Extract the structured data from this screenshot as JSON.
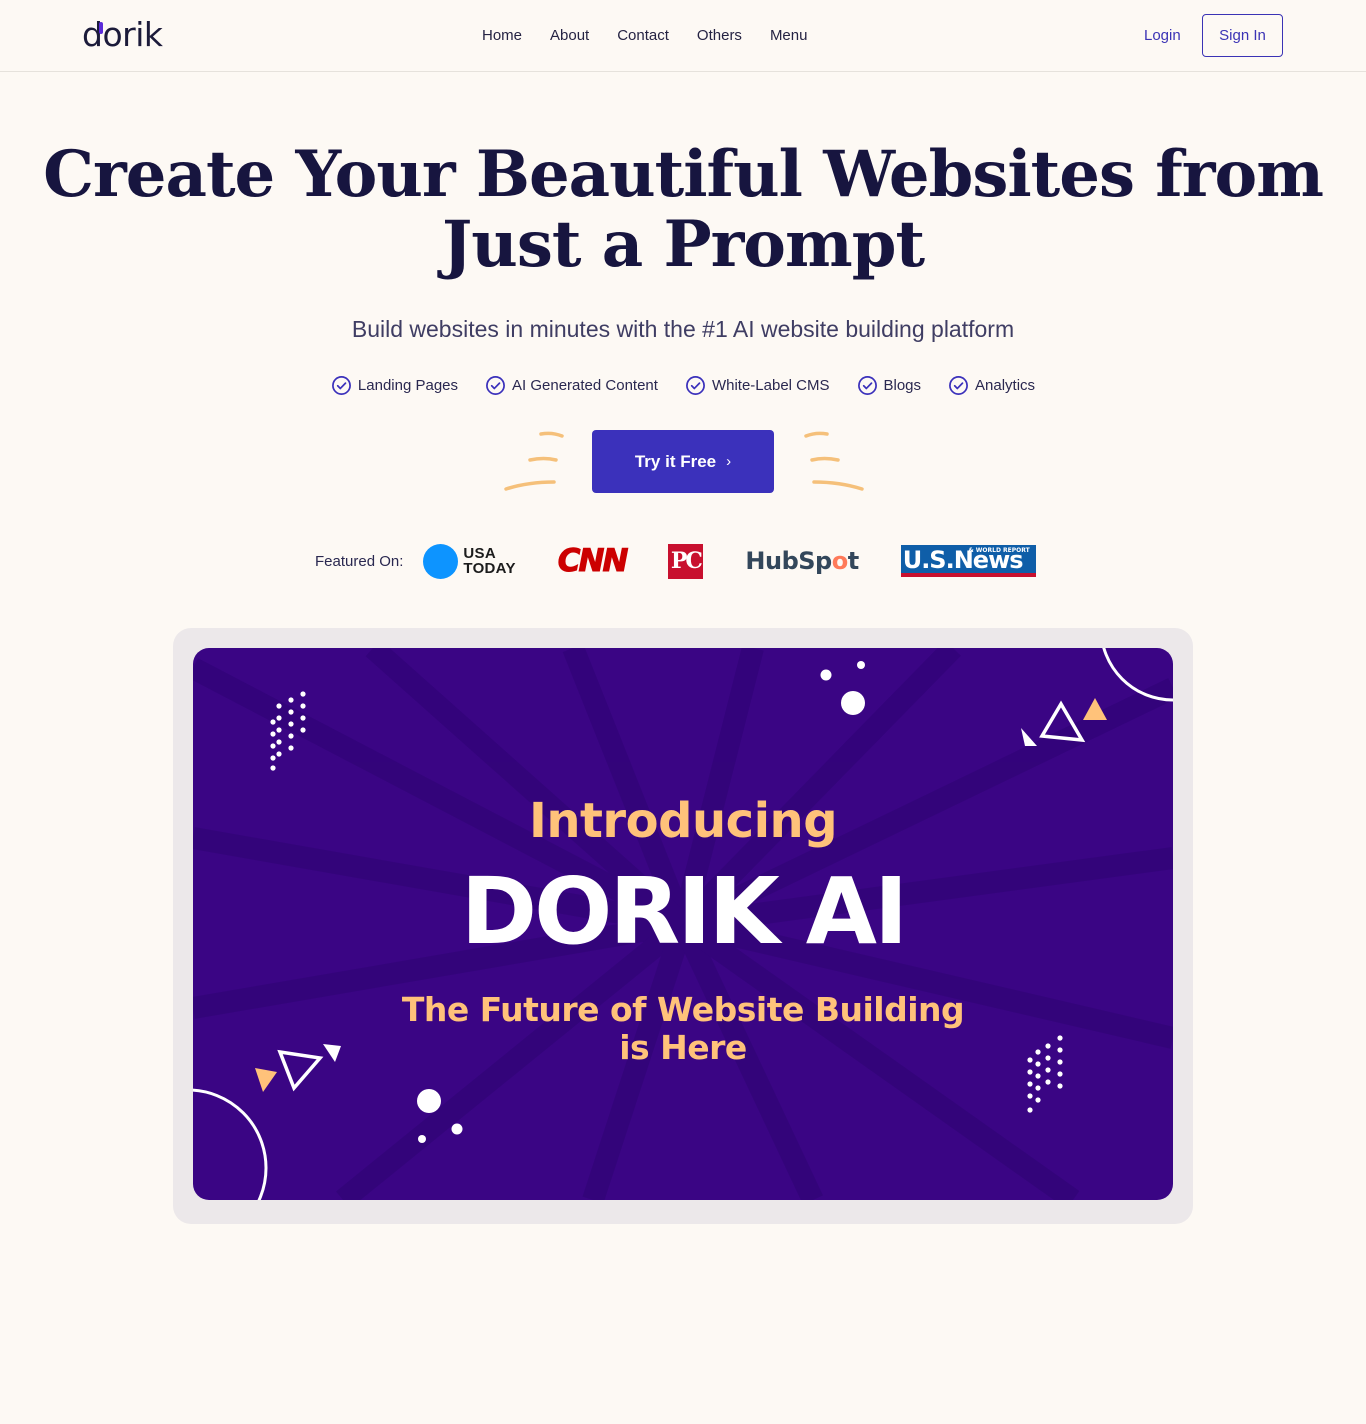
{
  "header": {
    "logo": "dorik",
    "nav": [
      "Home",
      "About",
      "Contact",
      "Others",
      "Menu"
    ],
    "login": "Login",
    "signin": "Sign In"
  },
  "hero": {
    "headline_line1": "Create Your Beautiful Websites from",
    "headline_line2": "Just a Prompt",
    "subline": "Build websites in minutes with the #1 AI website building platform",
    "features": [
      "Landing Pages",
      "AI Generated Content",
      "White-Label CMS",
      "Blogs",
      "Analytics"
    ],
    "cta": "Try it Free"
  },
  "featured": {
    "label": "Featured On:",
    "press": {
      "usa_today_1": "USA",
      "usa_today_2": "TODAY",
      "cnn": "CNN",
      "pc": "PC",
      "hubspot_a": "HubSp",
      "hubspot_o": "o",
      "hubspot_b": "t",
      "usnews_small": "& WORLD REPORT",
      "usnews": "U.S.News"
    }
  },
  "video": {
    "intro": "Introducing",
    "title": "DORIK AI",
    "tagline_line1": "The Future of Website Building",
    "tagline_line2": "is Here"
  },
  "colors": {
    "background": "#fdf9f4",
    "primary": "#3b31bb",
    "heading": "#17153f",
    "video_bg": "#3a0584",
    "accent_yellow": "#ffc27a"
  }
}
